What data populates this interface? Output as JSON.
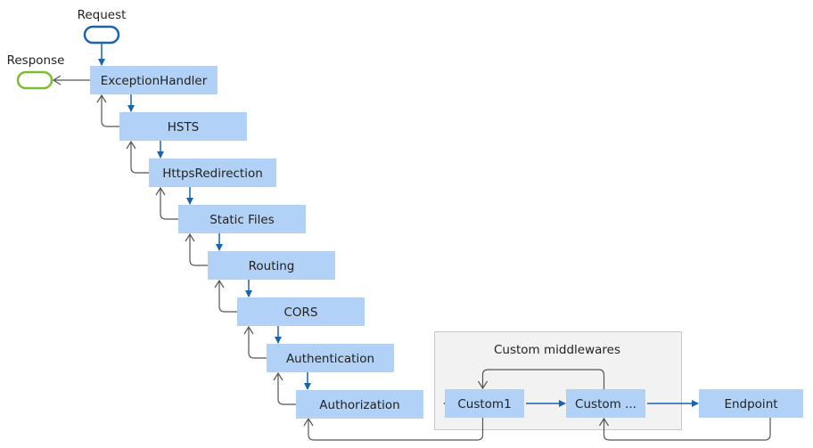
{
  "terminals": {
    "request": {
      "label": "Request",
      "color": "#1a64ad"
    },
    "response": {
      "label": "Response",
      "color": "#7cbd34"
    }
  },
  "pipeline": [
    {
      "id": "exception-handler",
      "label": "ExceptionHandler"
    },
    {
      "id": "hsts",
      "label": "HSTS"
    },
    {
      "id": "https-redirection",
      "label": "HttpsRedirection"
    },
    {
      "id": "static-files",
      "label": "Static Files"
    },
    {
      "id": "routing",
      "label": "Routing"
    },
    {
      "id": "cors",
      "label": "CORS"
    },
    {
      "id": "authentication",
      "label": "Authentication"
    },
    {
      "id": "authorization",
      "label": "Authorization"
    }
  ],
  "custom_group": {
    "title": "Custom middlewares",
    "nodes": [
      {
        "id": "custom1",
        "label": "Custom1"
      },
      {
        "id": "custom-more",
        "label": "Custom ..."
      }
    ]
  },
  "endpoint": {
    "id": "endpoint",
    "label": "Endpoint"
  },
  "colors": {
    "node_fill": "#b1d2f6",
    "forward_arrow": "#1a64ad",
    "return_arrow": "#555555",
    "container_fill": "#f2f2f2"
  }
}
